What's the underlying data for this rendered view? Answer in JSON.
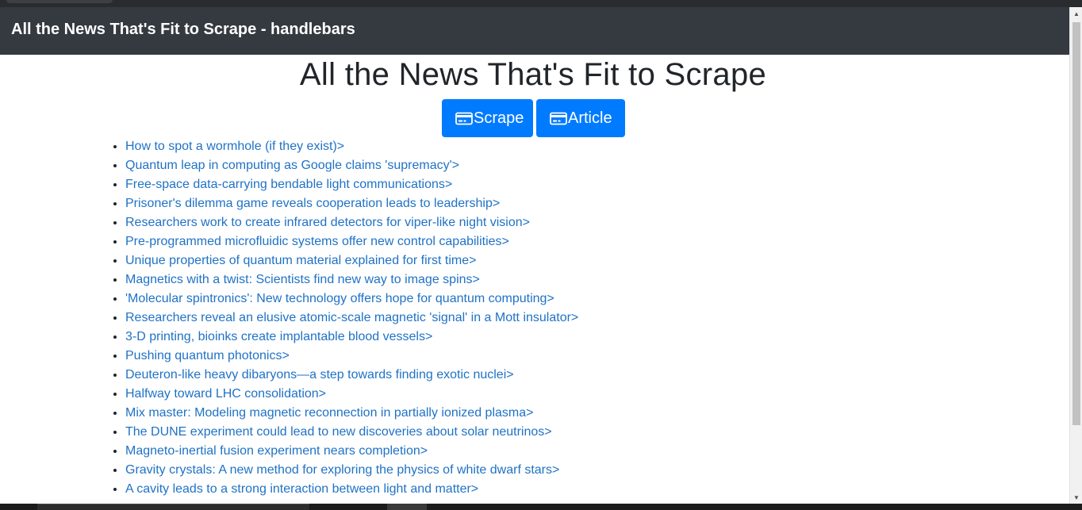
{
  "navbar": {
    "brand": "All the News That's Fit to Scrape - handlebars"
  },
  "page": {
    "heading": "All the News That's Fit to Scrape"
  },
  "buttons": {
    "scrape_label": "Scrape",
    "article_label": "Article",
    "icon": "credit-card-icon",
    "color": "#007bff"
  },
  "articles": [
    "How to spot a wormhole (if they exist)>",
    "Quantum leap in computing as Google claims 'supremacy'>",
    "Free-space data-carrying bendable light communications>",
    "Prisoner's dilemma game reveals cooperation leads to leadership>",
    "Researchers work to create infrared detectors for viper-like night vision>",
    "Pre-programmed microfluidic systems offer new control capabilities>",
    "Unique properties of quantum material explained for first time>",
    "Magnetics with a twist: Scientists find new way to image spins>",
    "'Molecular spintronics': New technology offers hope for quantum computing>",
    "Researchers reveal an elusive atomic-scale magnetic 'signal' in a Mott insulator>",
    "3-D printing, bioinks create implantable blood vessels>",
    "Pushing quantum photonics>",
    "Deuteron-like heavy dibaryons—a step towards finding exotic nuclei>",
    "Halfway toward LHC consolidation>",
    "Mix master: Modeling magnetic reconnection in partially ionized plasma>",
    "The DUNE experiment could lead to new discoveries about solar neutrinos>",
    "Magneto-inertial fusion experiment nears completion>",
    "Gravity crystals: A new method for exploring the physics of white dwarf stars>",
    "A cavity leads to a strong interaction between light and matter>"
  ],
  "colors": {
    "navbar": "#343a40",
    "link": "#1f72c6"
  }
}
